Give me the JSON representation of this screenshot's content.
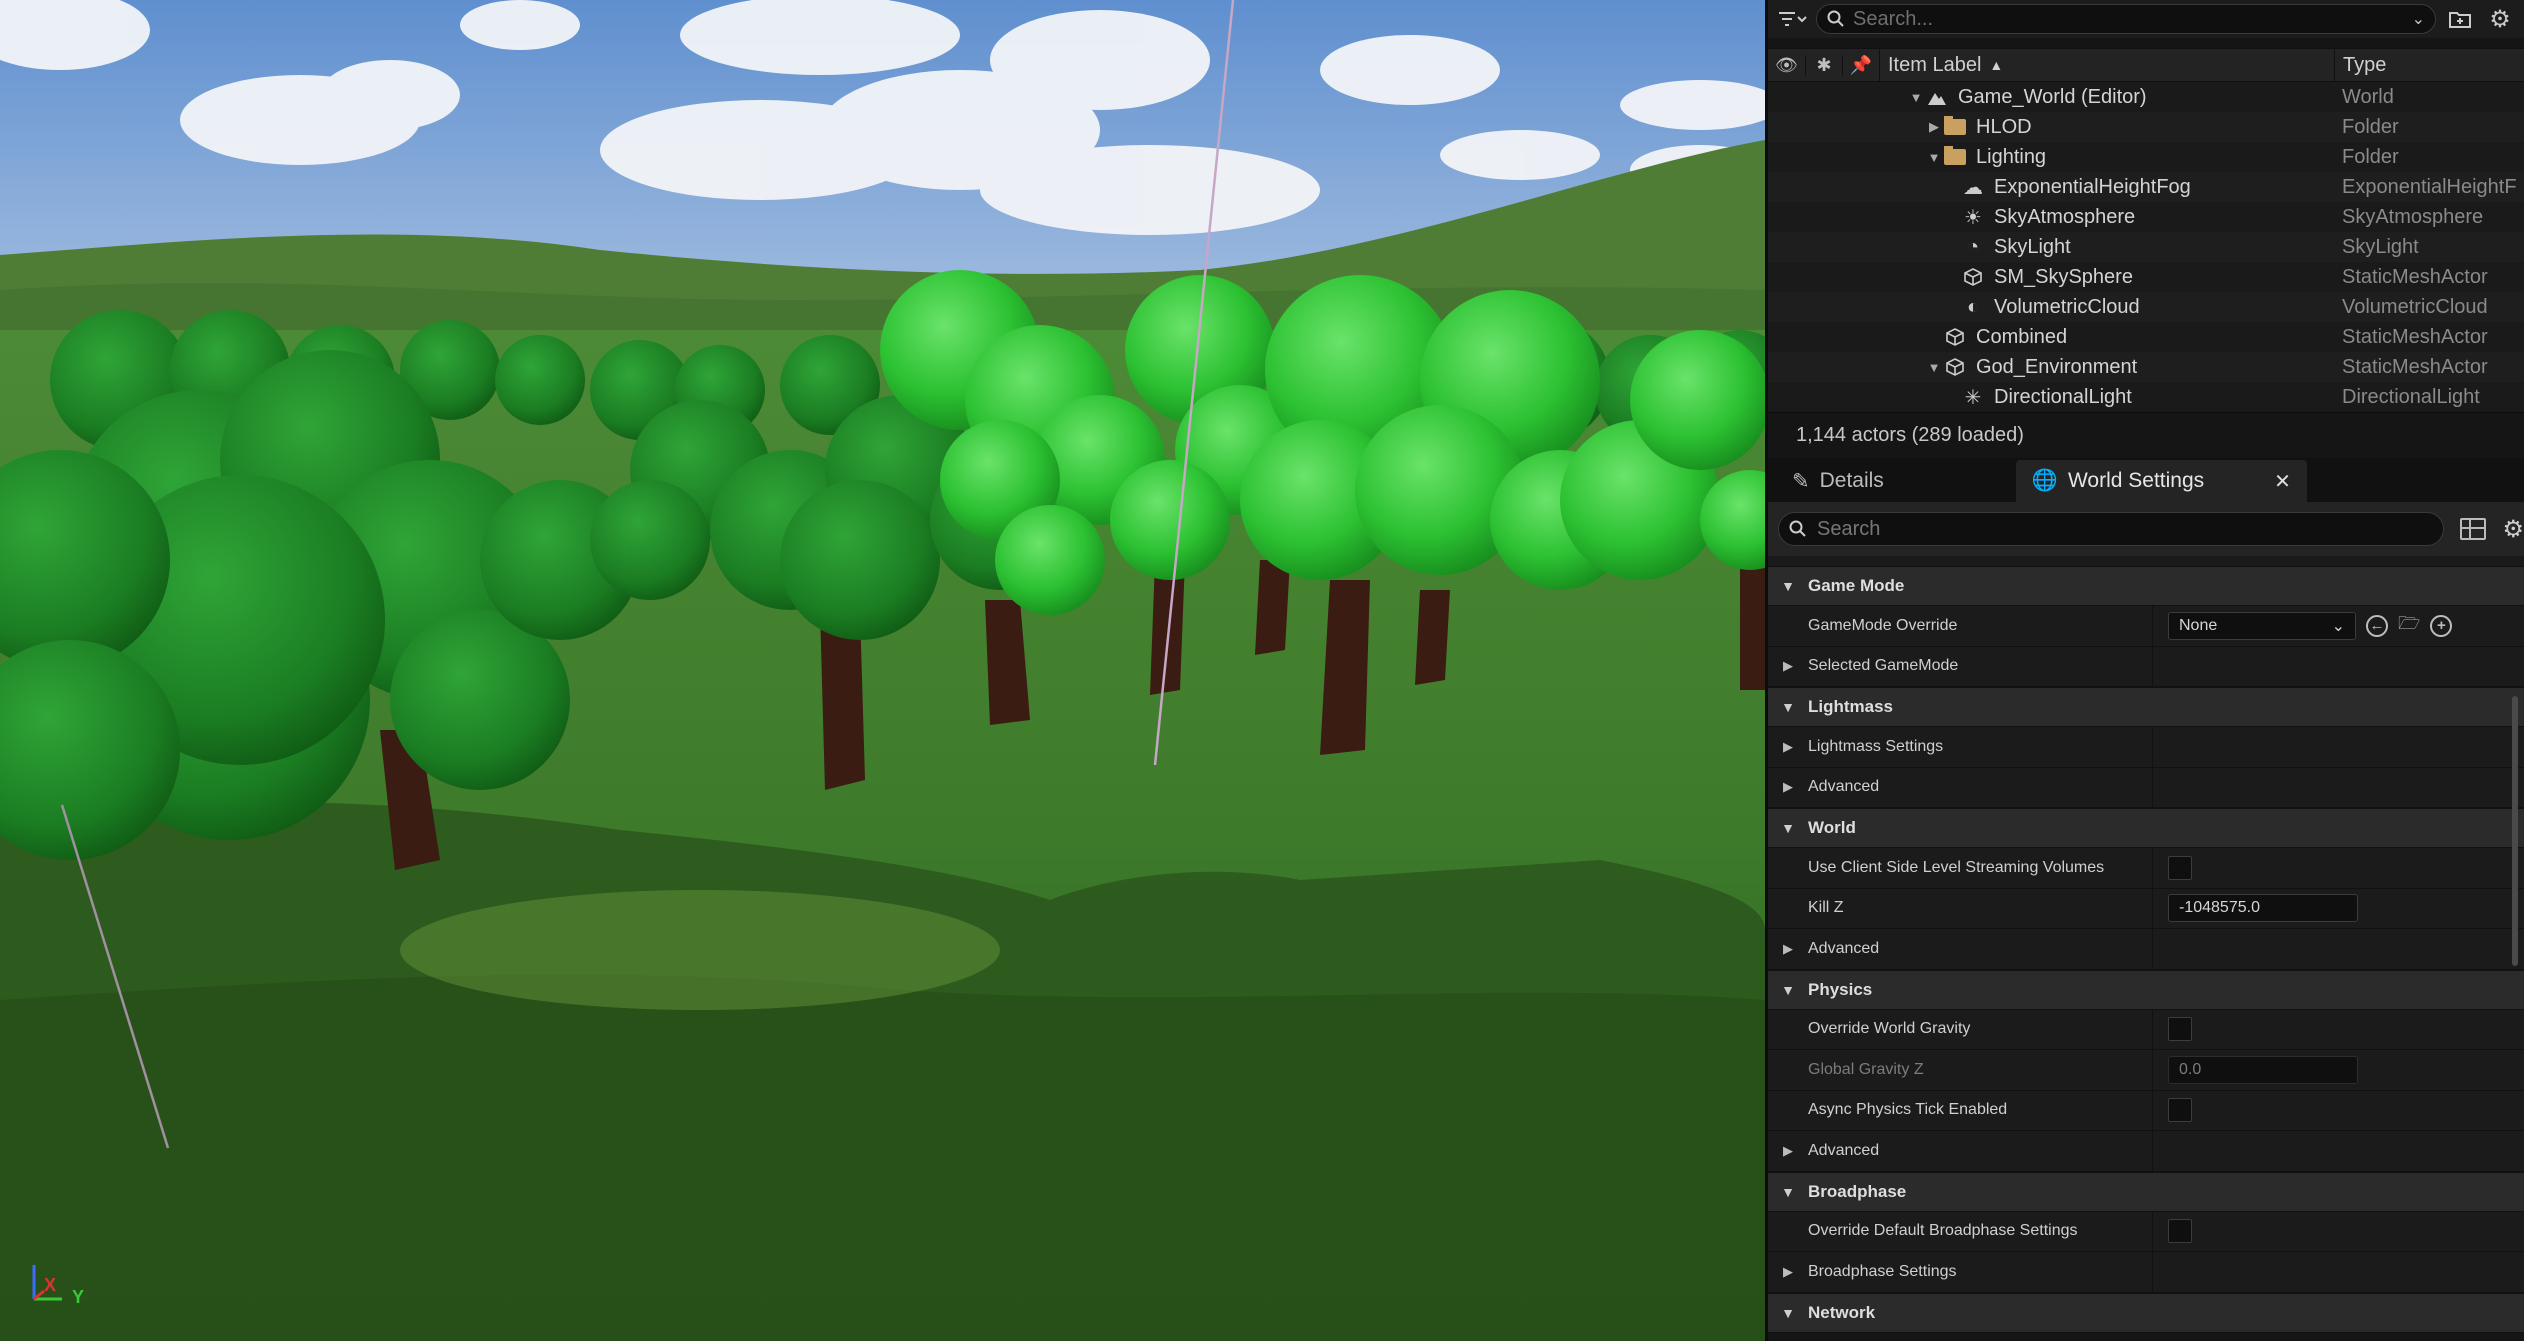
{
  "outliner": {
    "search_placeholder": "Search...",
    "columns": {
      "label": "Item Label",
      "type": "Type"
    },
    "rows": [
      {
        "name": "Game_World (Editor)",
        "type": "World"
      },
      {
        "name": "HLOD",
        "type": "Folder"
      },
      {
        "name": "Lighting",
        "type": "Folder"
      },
      {
        "name": "ExponentialHeightFog",
        "type": "ExponentialHeightF"
      },
      {
        "name": "SkyAtmosphere",
        "type": "SkyAtmosphere"
      },
      {
        "name": "SkyLight",
        "type": "SkyLight"
      },
      {
        "name": "SM_SkySphere",
        "type": "StaticMeshActor"
      },
      {
        "name": "VolumetricCloud",
        "type": "VolumetricCloud"
      },
      {
        "name": "Combined",
        "type": "StaticMeshActor"
      },
      {
        "name": "God_Environment",
        "type": "StaticMeshActor"
      },
      {
        "name": "DirectionalLight",
        "type": "DirectionalLight"
      }
    ],
    "status": "1,144 actors (289 loaded)"
  },
  "details": {
    "tabs": {
      "details": "Details",
      "world_settings": "World Settings"
    },
    "search_placeholder": "Search",
    "categories": {
      "game_mode": {
        "title": "Game Mode",
        "gamemode_override": {
          "label": "GameMode Override",
          "value": "None"
        },
        "selected_gamemode": "Selected GameMode"
      },
      "lightmass": {
        "title": "Lightmass",
        "lightmass_settings": "Lightmass Settings",
        "advanced": "Advanced"
      },
      "world": {
        "title": "World",
        "client_streaming": "Use Client Side Level Streaming Volumes",
        "kill_z": {
          "label": "Kill Z",
          "value": "-1048575.0"
        },
        "advanced": "Advanced"
      },
      "physics": {
        "title": "Physics",
        "override_gravity": "Override World Gravity",
        "global_gravity_z": {
          "label": "Global Gravity Z",
          "value": "0.0"
        },
        "async_tick": "Async Physics Tick Enabled",
        "advanced": "Advanced"
      },
      "broadphase": {
        "title": "Broadphase",
        "override_broadphase": "Override Default Broadphase Settings",
        "broadphase_settings": "Broadphase Settings"
      },
      "network": {
        "title": "Network"
      }
    }
  },
  "viewport": {
    "axis": {
      "x": "X",
      "y": "Y"
    },
    "colors": {
      "sky": "#7ea6d6",
      "grass": "#3f7a2c",
      "foliage": "#26b82a",
      "trunk": "#3c1d14"
    }
  }
}
